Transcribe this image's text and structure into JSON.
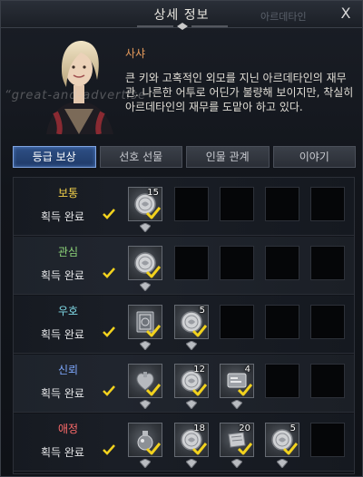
{
  "window": {
    "title": "상세 정보",
    "ghost_title": "아르데타인",
    "close_label": "X"
  },
  "character": {
    "name": "사샤",
    "description": "큰 키와 고혹적인 외모를 지닌 아르데타인의 재무관. 나른한 어투로 어딘가 불량해 보이지만, 착실히 아르데타인의 재무를 도맡아 하고 있다.",
    "watermark": "“great-and-advertise"
  },
  "tabs": [
    {
      "label": "등급 보상",
      "active": true
    },
    {
      "label": "선호 선물",
      "active": false
    },
    {
      "label": "인물 관계",
      "active": false
    },
    {
      "label": "이야기",
      "active": false
    }
  ],
  "status_label": "획득 완료",
  "colors": {
    "check": "#f2d21e",
    "tier_normal": "#f4d24a",
    "tier_interest": "#8fd77a",
    "tier_favor": "#7fd9e6",
    "tier_trust": "#7fa9ff",
    "tier_affection": "#ff6b6b"
  },
  "tiers": [
    {
      "name": "보통",
      "color": "#f4d24a",
      "slots": [
        {
          "icon": "coin-icon",
          "count": "15"
        },
        null,
        null,
        null,
        null
      ]
    },
    {
      "name": "관심",
      "color": "#8fd77a",
      "slots": [
        {
          "icon": "coin-icon",
          "count": ""
        },
        null,
        null,
        null,
        null
      ]
    },
    {
      "name": "우호",
      "color": "#7fd9e6",
      "slots": [
        {
          "icon": "book-icon",
          "count": ""
        },
        {
          "icon": "coin-icon",
          "count": "5"
        },
        null,
        null,
        null
      ]
    },
    {
      "name": "신뢰",
      "color": "#7fa9ff",
      "slots": [
        {
          "icon": "heart-statue-icon",
          "count": ""
        },
        {
          "icon": "coin-icon",
          "count": "12"
        },
        {
          "icon": "card-icon",
          "count": "4"
        },
        null,
        null
      ]
    },
    {
      "name": "애정",
      "color": "#ff6b6b",
      "slots": [
        {
          "icon": "potion-icon",
          "count": ""
        },
        {
          "icon": "coin-icon",
          "count": "18"
        },
        {
          "icon": "scroll-icon",
          "count": "20"
        },
        {
          "icon": "coin-icon",
          "count": "5"
        },
        null
      ]
    }
  ]
}
